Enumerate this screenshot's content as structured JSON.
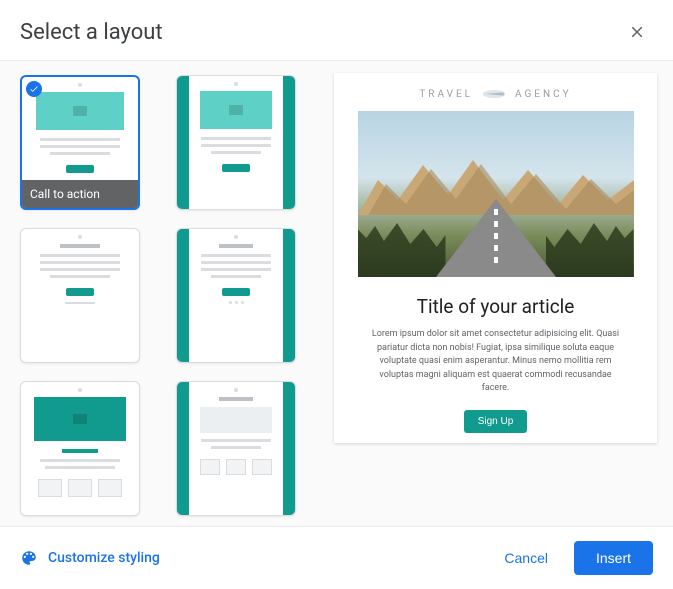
{
  "dialog": {
    "title": "Select a layout"
  },
  "layouts": {
    "selected_index": 0,
    "items": [
      {
        "label": "Call to action"
      },
      {
        "label": ""
      },
      {
        "label": ""
      },
      {
        "label": ""
      },
      {
        "label": ""
      },
      {
        "label": ""
      }
    ]
  },
  "preview": {
    "logo_left": "TRAVEL",
    "logo_right": "AGENCY",
    "article_title": "Title of your article",
    "article_body": "Lorem ipsum dolor sit amet consectetur adipisicing elit. Quasi pariatur dicta non nobis! Fugiat, ipsa similique soluta eaque voluptate quasi enim asperantur. Minus nemo mollitia rem voluptas magni aliquam est quaerat commodi recusandae facere.",
    "signup_label": "Sign Up"
  },
  "footer": {
    "customize_label": "Customize styling",
    "cancel_label": "Cancel",
    "insert_label": "Insert"
  }
}
